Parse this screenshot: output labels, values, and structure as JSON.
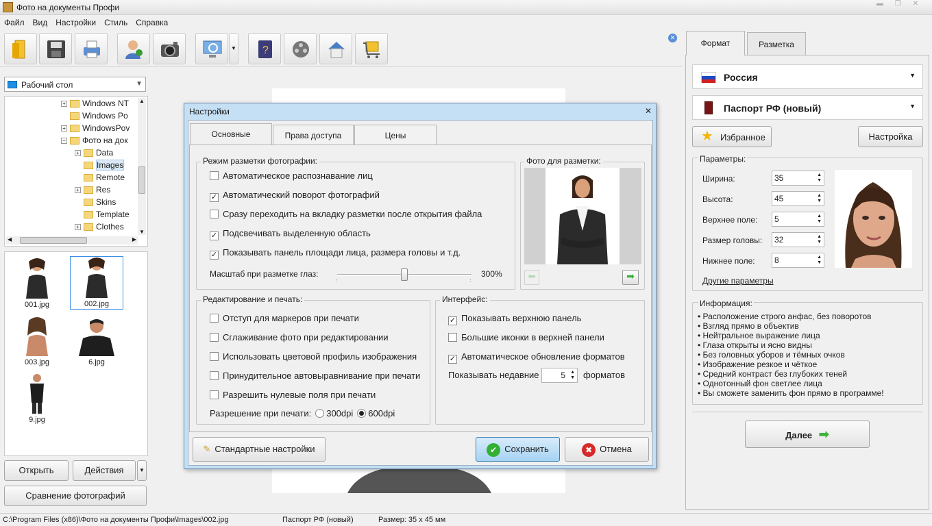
{
  "window": {
    "title": "Фото на документы Профи"
  },
  "menu": [
    "Файл",
    "Вид",
    "Настройки",
    "Стиль",
    "Справка"
  ],
  "left": {
    "location": "Рабочий стол",
    "tree": [
      {
        "label": "Windows NT",
        "expand": "+"
      },
      {
        "label": "Windows Po",
        "expand": ""
      },
      {
        "label": "WindowsPov",
        "expand": "+"
      },
      {
        "label": "Фото на док",
        "expand": "-"
      },
      {
        "label": "Data",
        "expand": "+"
      },
      {
        "label": "Images",
        "expand": ""
      },
      {
        "label": "Remote",
        "expand": ""
      },
      {
        "label": "Res",
        "expand": "+"
      },
      {
        "label": "Skins",
        "expand": ""
      },
      {
        "label": "Template",
        "expand": ""
      },
      {
        "label": "Clothes",
        "expand": "+"
      }
    ],
    "thumbs": [
      "001.jpg",
      "002.jpg",
      "003.jpg",
      "6.jpg",
      "9.jpg"
    ],
    "open_btn": "Открыть",
    "actions_btn": "Действия",
    "compare_btn": "Сравнение фотографий"
  },
  "status": {
    "path": "C:\\Program Files (x86)\\Фото на документы Профи\\Images\\002.jpg",
    "format": "Паспорт РФ (новый)",
    "size": "Размер: 35 x 45 мм"
  },
  "right": {
    "tabs": [
      "Формат",
      "Разметка"
    ],
    "country": "Россия",
    "doc": "Паспорт РФ (новый)",
    "fav_btn": "Избранное",
    "settings_btn": "Настройка",
    "params_title": "Параметры:",
    "params": [
      {
        "label": "Ширина:",
        "value": "35"
      },
      {
        "label": "Высота:",
        "value": "45"
      },
      {
        "label": "Верхнее поле:",
        "value": "5"
      },
      {
        "label": "Размер головы:",
        "value": "32"
      },
      {
        "label": "Нижнее поле:",
        "value": "8"
      }
    ],
    "other_params": "Другие параметры",
    "info_title": "Информация:",
    "info": [
      "Расположение строго анфас, без поворотов",
      "Взгляд прямо в объектив",
      "Нейтральное выражение лица",
      "Глаза открыты и ясно видны",
      "Без головных уборов и тёмных очков",
      "Изображение резкое и чёткое",
      "Средний контраст без глубоких теней",
      "Однотонный фон светлее лица",
      "Вы сможете заменить фон прямо в программе!"
    ],
    "next_btn": "Далее"
  },
  "dialog": {
    "title": "Настройки",
    "tabs": [
      "Основные",
      "Права доступа",
      "Цены"
    ],
    "mode_title": "Режим разметки фотографии:",
    "mode_options": [
      {
        "label": "Автоматическое распознавание лиц",
        "checked": false
      },
      {
        "label": "Автоматический поворот фотографий",
        "checked": true
      },
      {
        "label": "Сразу переходить на вкладку разметки после открытия файла",
        "checked": false
      },
      {
        "label": "Подсвечивать выделенную область",
        "checked": true
      },
      {
        "label": "Показывать панель площади лица, размера головы и т.д.",
        "checked": true
      }
    ],
    "scale_label": "Масштаб при разметке глаз:",
    "scale_value": "300%",
    "scale_level": 0.5,
    "photo_title": "Фото для разметки:",
    "edit_title": "Редактирование и печать:",
    "edit_options": [
      {
        "label": "Отступ для маркеров при печати",
        "checked": false
      },
      {
        "label": "Сглаживание фото при редактировании",
        "checked": false
      },
      {
        "label": "Использовать цветовой профиль изображения",
        "checked": false
      },
      {
        "label": "Принудительное автовыравнивание при печати",
        "checked": false
      },
      {
        "label": "Разрешить нулевые поля при печати",
        "checked": false
      }
    ],
    "resolution_label": "Разрешение при печати:",
    "res_300": "300dpi",
    "res_600": "600dpi",
    "res_selected": "600dpi",
    "iface_title": "Интерфейс:",
    "iface_options": [
      {
        "label": "Показывать верхнюю панель",
        "checked": true
      },
      {
        "label": "Большие иконки в верхней панели",
        "checked": false
      },
      {
        "label": "Автоматическое обновление форматов",
        "checked": true
      }
    ],
    "recent_label": "Показывать недавние",
    "recent_value": "5",
    "recent_suffix": "форматов",
    "default_btn": "Стандартные настройки",
    "save_btn": "Сохранить",
    "cancel_btn": "Отмена"
  }
}
